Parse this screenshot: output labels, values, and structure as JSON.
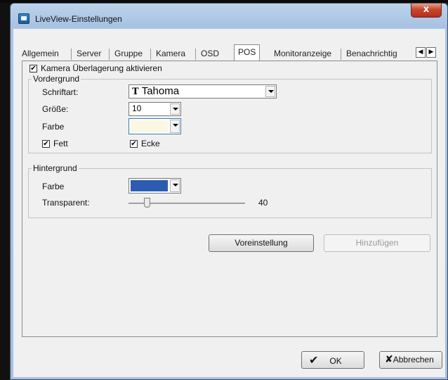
{
  "window": {
    "title": "LiveView-Einstellungen",
    "close_glyph": "x"
  },
  "tabs": [
    {
      "label": "Allgemein"
    },
    {
      "label": "Server"
    },
    {
      "label": "Gruppe"
    },
    {
      "label": "Kamera"
    },
    {
      "label": "OSD"
    },
    {
      "label": "POS",
      "active": true
    },
    {
      "label": "Monitoranzeige"
    },
    {
      "label": "Benachrichtig"
    }
  ],
  "tab_scroll": {
    "left_glyph": "◀",
    "right_glyph": "▶"
  },
  "overlay": {
    "label": "Kamera Überlagerung aktivieren",
    "checked": true,
    "check_glyph": "✔"
  },
  "foreground": {
    "title": "Vordergrund",
    "font_label": "Schriftart:",
    "font_icon": "T",
    "font_value": "Tahoma",
    "size_label": "Größe:",
    "size_value": "10",
    "color_label": "Farbe",
    "color_value": "#fcf7e3",
    "bold_label": "Fett",
    "corner_label": "Ecke"
  },
  "background": {
    "title": "Hintergrund",
    "color_label": "Farbe",
    "color_value": "#2b5cb2",
    "transparent_label": "Transparent:",
    "transparent_value": "40"
  },
  "buttons": {
    "preset": "Voreinstellung",
    "add": "Hinzufügen",
    "ok": "OK",
    "ok_icon": "✔",
    "cancel": "Abbrechen",
    "cancel_icon": "✘"
  }
}
